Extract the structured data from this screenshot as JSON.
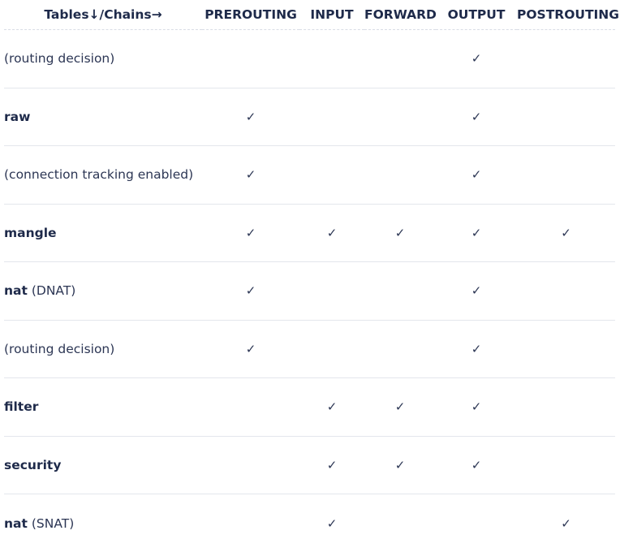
{
  "header": {
    "corner": "Tables↓/Chains→",
    "chains": [
      "PREROUTING",
      "INPUT",
      "FORWARD",
      "OUTPUT",
      "POSTROUTING"
    ]
  },
  "check_symbol": "✓",
  "rows": [
    {
      "name": "",
      "note": "(routing decision)",
      "checks": [
        false,
        false,
        false,
        true,
        false
      ]
    },
    {
      "name": "raw",
      "note": "",
      "checks": [
        true,
        false,
        false,
        true,
        false
      ]
    },
    {
      "name": "",
      "note": "(connection tracking enabled)",
      "checks": [
        true,
        false,
        false,
        true,
        false
      ]
    },
    {
      "name": "mangle",
      "note": "",
      "checks": [
        true,
        true,
        true,
        true,
        true
      ]
    },
    {
      "name": "nat",
      "note": "(DNAT)",
      "checks": [
        true,
        false,
        false,
        true,
        false
      ]
    },
    {
      "name": "",
      "note": "(routing decision)",
      "checks": [
        true,
        false,
        false,
        true,
        false
      ]
    },
    {
      "name": "filter",
      "note": "",
      "checks": [
        false,
        true,
        true,
        true,
        false
      ]
    },
    {
      "name": "security",
      "note": "",
      "checks": [
        false,
        true,
        true,
        true,
        false
      ]
    },
    {
      "name": "nat",
      "note": "(SNAT)",
      "checks": [
        false,
        true,
        false,
        false,
        true
      ]
    }
  ]
}
